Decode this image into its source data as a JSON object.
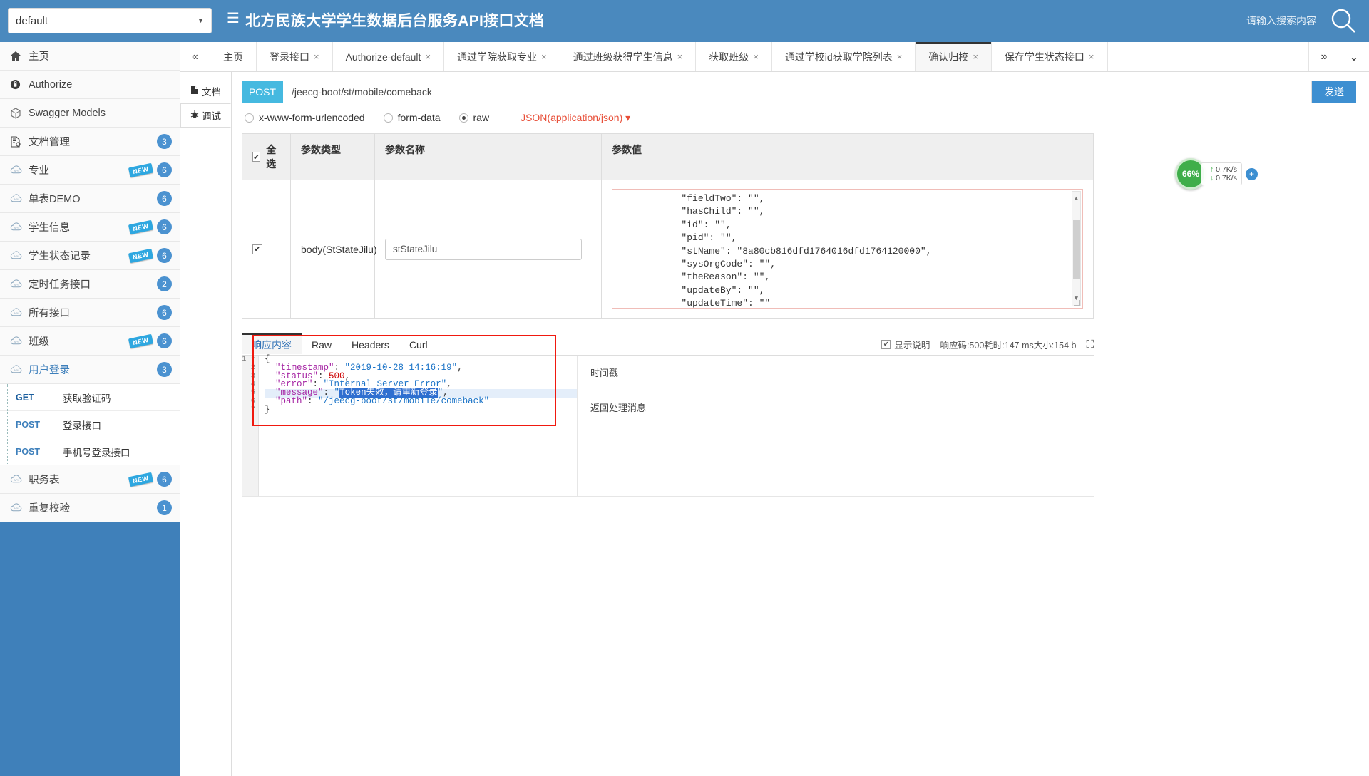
{
  "header": {
    "group_select_value": "default",
    "menu_icon": "hamburger-icon",
    "title": "北方民族大学学生数据后台服务API接口文档",
    "search_placeholder": "请输入搜索内容",
    "search_icon": "search-icon",
    "brand_color": "#4a89be"
  },
  "sidebar": {
    "items": [
      {
        "label": "主页",
        "icon": "home-icon",
        "badge": "",
        "new": false,
        "link": false
      },
      {
        "label": "Authorize",
        "icon": "lock-icon",
        "badge": "",
        "new": false,
        "link": false
      },
      {
        "label": "Swagger Models",
        "icon": "cube-icon",
        "badge": "",
        "new": false,
        "link": false
      },
      {
        "label": "文档管理",
        "icon": "document-icon",
        "badge": "3",
        "new": false,
        "link": false
      },
      {
        "label": "专业",
        "icon": "cloud-api-icon",
        "badge": "6",
        "new": true,
        "link": false
      },
      {
        "label": "单表DEMO",
        "icon": "cloud-api-icon",
        "badge": "6",
        "new": false,
        "link": false
      },
      {
        "label": "学生信息",
        "icon": "cloud-api-icon",
        "badge": "6",
        "new": true,
        "link": false
      },
      {
        "label": "学生状态记录",
        "icon": "cloud-api-icon",
        "badge": "6",
        "new": true,
        "link": false
      },
      {
        "label": "定时任务接口",
        "icon": "cloud-api-icon",
        "badge": "2",
        "new": false,
        "link": false
      },
      {
        "label": "所有接口",
        "icon": "cloud-api-icon",
        "badge": "6",
        "new": false,
        "link": false
      },
      {
        "label": "班级",
        "icon": "cloud-api-icon",
        "badge": "6",
        "new": true,
        "link": false
      },
      {
        "label": "用户登录",
        "icon": "cloud-api-icon",
        "badge": "3",
        "new": false,
        "link": true
      }
    ],
    "sub_items": [
      {
        "verb": "GET",
        "label": "获取验证码"
      },
      {
        "verb": "POST",
        "label": "登录接口"
      },
      {
        "verb": "POST",
        "label": "手机号登录接口"
      }
    ],
    "items_after": [
      {
        "label": "职务表",
        "icon": "cloud-api-icon",
        "badge": "6",
        "new": true,
        "link": false
      },
      {
        "label": "重复校验",
        "icon": "cloud-api-icon",
        "badge": "1",
        "new": false,
        "link": false
      }
    ],
    "new_tag_text": "NEW"
  },
  "tabs": {
    "collapse_left_icon": "chevron-double-left-icon",
    "overflow_right_icon": "chevron-double-right-icon",
    "dropdown_icon": "chevron-double-down-icon",
    "items": [
      {
        "label": "主页",
        "closable": false,
        "active": false
      },
      {
        "label": "登录接口",
        "closable": true,
        "active": false
      },
      {
        "label": "Authorize-default",
        "closable": true,
        "active": false
      },
      {
        "label": "通过学院获取专业",
        "closable": true,
        "active": false
      },
      {
        "label": "通过班级获得学生信息",
        "closable": true,
        "active": false
      },
      {
        "label": "获取班级",
        "closable": true,
        "active": false
      },
      {
        "label": "通过学校id获取学院列表",
        "closable": true,
        "active": false
      },
      {
        "label": "确认归校",
        "closable": true,
        "active": true
      },
      {
        "label": "保存学生状态接口",
        "closable": true,
        "active": false
      }
    ],
    "close_glyph": "×"
  },
  "vtabs": [
    {
      "label": "文档",
      "icon": "file-icon",
      "active": false
    },
    {
      "label": "调试",
      "icon": "bug-icon",
      "active": true
    }
  ],
  "request": {
    "method": "POST",
    "url": "/jeecg-boot/st/mobile/comeback",
    "send_label": "发送",
    "body_types": [
      {
        "label": "x-www-form-urlencoded",
        "selected": false
      },
      {
        "label": "form-data",
        "selected": false
      },
      {
        "label": "raw",
        "selected": true
      }
    ],
    "content_type": "JSON(application/json)",
    "content_type_caret": "caret-down-icon"
  },
  "param_table": {
    "headers": {
      "select_all": "全选",
      "param_type": "参数类型",
      "param_name": "参数名称",
      "param_value": "参数值"
    },
    "select_all_checked": true,
    "rows": [
      {
        "checked": true,
        "type": "body(StStateJilu)",
        "name_value": "stStateJilu",
        "json_lines": [
          "        \"fieldTwo\": \"\",",
          "        \"hasChild\": \"\",",
          "        \"id\": \"\",",
          "        \"pid\": \"\",",
          "        \"stName\": \"8a80cb816dfd1764016dfd1764120000\",",
          "        \"sysOrgCode\": \"\",",
          "        \"theReason\": \"\",",
          "        \"updateBy\": \"\",",
          "        \"updateTime\": \"\"",
          "    }"
        ]
      }
    ]
  },
  "response": {
    "tabs": [
      {
        "label": "响应内容",
        "active": true
      },
      {
        "label": "Raw",
        "active": false
      },
      {
        "label": "Headers",
        "active": false
      },
      {
        "label": "Curl",
        "active": false
      }
    ],
    "show_desc_label": "显示说明",
    "show_desc_checked": true,
    "status_line": "响应码:500耗时:147 ms大小:154 b",
    "expand_icon": "expand-icon",
    "code_lines": [
      {
        "no": "1",
        "fold": true,
        "text": "{"
      },
      {
        "no": "2",
        "text": "  \"timestamp\": \"2019-10-28 14:16:19\","
      },
      {
        "no": "3",
        "text": "  \"status\": 500,"
      },
      {
        "no": "4",
        "text": "  \"error\": \"Internal Server Error\","
      },
      {
        "no": "5",
        "text": "  \"message\": \"Token失效，请重新登录\","
      },
      {
        "no": "6",
        "text": "  \"path\": \"/jeecg-boot/st/mobile/comeback\""
      },
      {
        "no": "7",
        "text": "}"
      }
    ],
    "descriptions": [
      "时间戳",
      "返回处理消息"
    ]
  },
  "speed_widget": {
    "percent": "66%",
    "upload": "0.7K/s",
    "download": "0.7K/s",
    "up_arrow": "▲",
    "down_arrow": "▼",
    "plus": "+"
  }
}
